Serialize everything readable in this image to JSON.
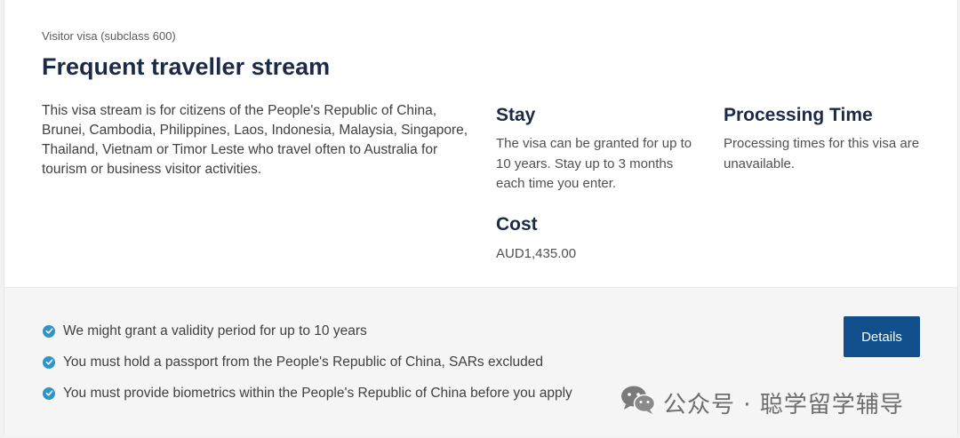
{
  "visa": {
    "eyebrow": "Visitor visa (subclass 600)",
    "title": "Frequent traveller stream",
    "description": "This visa stream is for citizens of the People's Republic of China, Brunei, Cambodia, Philippines, Laos, Indonesia, Malaysia, Singapore, Thailand, Vietnam or Timor Leste who travel often to Australia for tourism or business visitor activities."
  },
  "stay": {
    "heading": "Stay",
    "text": "The visa can be granted for up to 10 years. Stay up to 3 months each time you enter."
  },
  "processing": {
    "heading": "Processing Time",
    "text": "Processing times for this visa are unavailable."
  },
  "cost": {
    "heading": "Cost",
    "value": "AUD1,435.00"
  },
  "checklist": [
    {
      "text": "We might grant a validity period for up to 10 years",
      "icon": "check-circle-icon"
    },
    {
      "text": "You must hold a passport from the People's Republic of China, SARs excluded",
      "icon": "check-circle-icon"
    },
    {
      "text": "You must provide biometrics within the People's Republic of China before you apply",
      "icon": "check-circle-icon"
    }
  ],
  "details_button": {
    "label": "Details"
  },
  "watermark": {
    "text": "公众号 · 聪学留学辅导",
    "icon": "wechat-icon"
  },
  "colors": {
    "title": "#1b2a47",
    "accent": "#114e8c",
    "check": "#2f95c8"
  }
}
